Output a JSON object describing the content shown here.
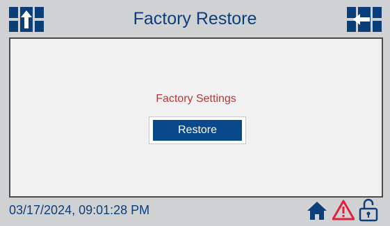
{
  "header": {
    "title": "Factory Restore",
    "left_icon": "previous-screen-icon",
    "right_icon": "next-screen-icon"
  },
  "main": {
    "section_label": "Factory Settings",
    "restore_button_label": "Restore"
  },
  "footer": {
    "datetime": "03/17/2024, 09:01:28 PM",
    "icons": [
      "home-icon",
      "alarm-warning-icon",
      "unlocked-padlock-icon"
    ]
  },
  "colors": {
    "background": "#cfd1d3",
    "title_blue": "#0b3f7a",
    "button_blue": "#0a4a8c",
    "label_red": "#b5393a",
    "alarm_red": "#e0203a"
  }
}
